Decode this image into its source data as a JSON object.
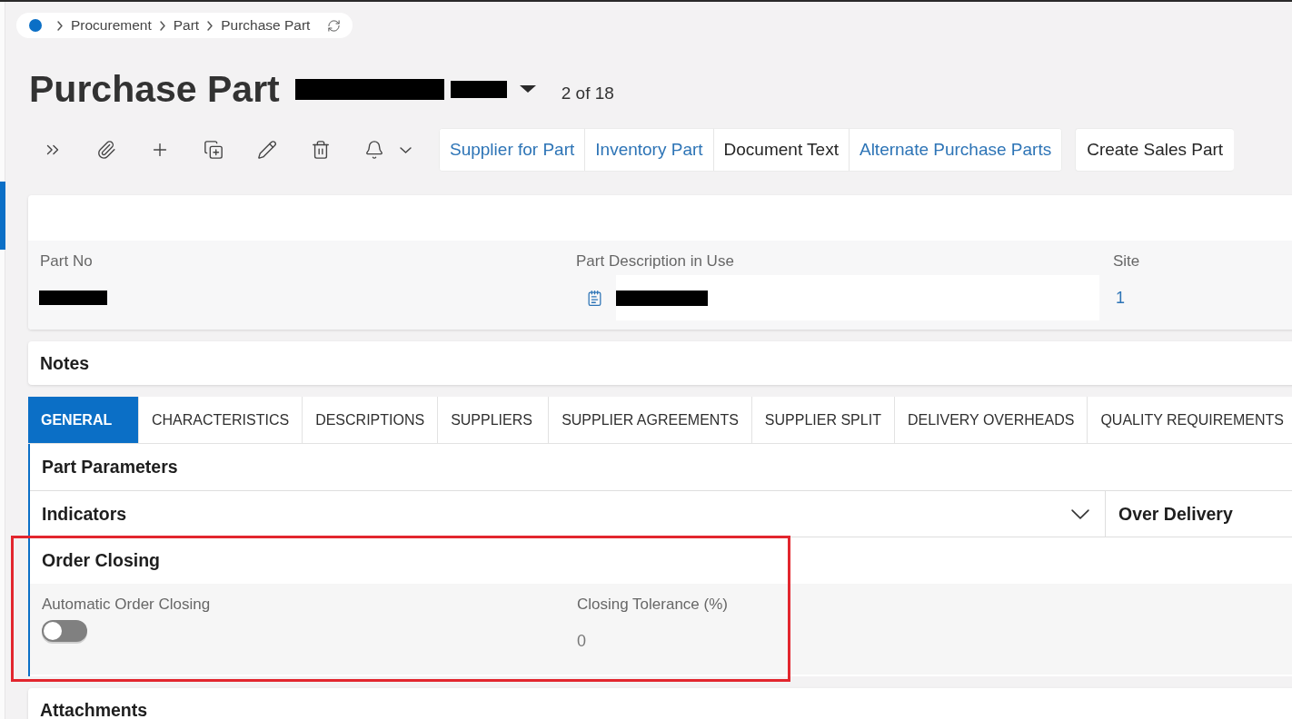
{
  "breadcrumb": {
    "items": [
      "Procurement",
      "Part",
      "Purchase Part"
    ]
  },
  "header": {
    "title": "Purchase Part",
    "record_redacted": true,
    "record_position": "2 of 18"
  },
  "toolbar": {
    "commands": [
      {
        "label": "Supplier for Part",
        "kind": "link"
      },
      {
        "label": "Inventory Part",
        "kind": "link"
      },
      {
        "label": "Document Text",
        "kind": "action"
      },
      {
        "label": "Alternate Purchase Parts",
        "kind": "link"
      }
    ],
    "extra_commands": [
      {
        "label": "Create Sales Part",
        "kind": "action"
      }
    ]
  },
  "record": {
    "fields": [
      {
        "label": "Part No",
        "kind": "text",
        "redacted": true
      },
      {
        "label": "Part Description in Use",
        "kind": "note",
        "redacted": true
      },
      {
        "label": "Site",
        "kind": "link",
        "value": "1"
      }
    ]
  },
  "notes": {
    "title": "Notes"
  },
  "tabs": [
    {
      "label": "GENERAL",
      "selected": true
    },
    {
      "label": "CHARACTERISTICS",
      "selected": false
    },
    {
      "label": "DESCRIPTIONS",
      "selected": false
    },
    {
      "label": "SUPPLIERS",
      "selected": false
    },
    {
      "label": "SUPPLIER AGREEMENTS",
      "selected": false
    },
    {
      "label": "SUPPLIER SPLIT",
      "selected": false
    },
    {
      "label": "DELIVERY OVERHEADS",
      "selected": false
    },
    {
      "label": "QUALITY REQUIREMENTS",
      "selected": false
    }
  ],
  "panel": {
    "title": "Part Parameters",
    "indicators": {
      "title": "Indicators",
      "expanded": false
    },
    "over_delivery": {
      "title": "Over Delivery"
    },
    "order_closing": {
      "title": "Order Closing",
      "highlighted": true,
      "automatic_order_closing": {
        "label": "Automatic Order Closing",
        "on": false
      },
      "closing_tolerance": {
        "label": "Closing Tolerance (%)",
        "value": "0"
      }
    }
  },
  "attachments": {
    "title": "Attachments"
  }
}
